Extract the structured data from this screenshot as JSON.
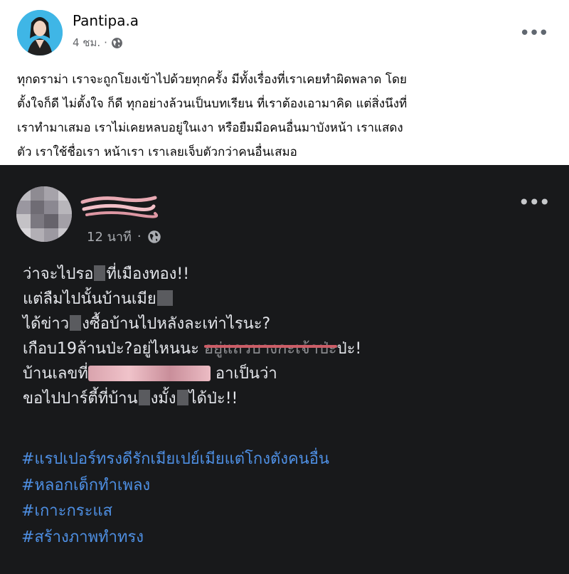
{
  "top_post": {
    "author": "Pantipa.a",
    "time": "4 ชม.",
    "time_separator": "·",
    "more_icon": "more-horizontal-icon",
    "privacy_icon": "globe-icon",
    "lines": [
      "ทุกดราม่า เราจะถูกโยงเข้าไปด้วยทุกครั้ง มีทั้งเรื่องที่เราเคยทำผิดพลาด โดย",
      "ตั้งใจก็ดี ไม่ตั้งใจ ก็ดี ทุกอย่างล้วนเป็นบทเรียน ที่เราต้องเอามาคิด แต่สิ่งนึงที่",
      "เราทำมาเสมอ เราไม่เคยหลบอยู่ในเงา  หรือยืมมือคนอื่นมาบังหน้า เราแสดง",
      "ตัว เราใช้ชื่อเรา หน้าเรา เราเลยเจ็บตัวกว่าคนอื่นเสมอ"
    ]
  },
  "shared_post": {
    "time": "12 นาที",
    "time_separator": "·",
    "more_icon": "more-horizontal-icon",
    "privacy_icon": "globe-icon",
    "line1_a": "ว่าจะไปรอ",
    "line1_b": "ที่เมืองทอง!!",
    "line2_a": "แต่ลืมไปนั้นบ้านเมีย",
    "line3_a": "ได้ข่าว",
    "line3_b": "งซื้อบ้านไปหลังละเท่าไรนะ?",
    "line4_a": "เกือบ19ล้านป่ะ?อยู่ไหนนะ",
    "line4_struck": "อยู่แถวบางกะเจ้าป่ะ",
    "line4_b": "ป่ะ!",
    "line5_a": "บ้านเลขที่",
    "line5_b": "อาเป็นว่า",
    "line6_a": "ขอไปปาร์ตี้ที่บ้าน",
    "line6_b": "งมั้ง",
    "line6_c": "ได้ป่ะ!!",
    "hashtags": [
      "#แรปเปอร์ทรงดีรักเมียเปย์เมียแต่โกงตังคนอื่น",
      "#หลอกเด็กทำเพลง",
      "#เกาะกระแส",
      "#สร้างภาพทำทรง"
    ]
  },
  "colors": {
    "dark_bg": "#18191b",
    "hashtag": "#4e8fe3",
    "dark_text": "#e4e6eb",
    "avatar_bg": "#3fb6e6"
  }
}
